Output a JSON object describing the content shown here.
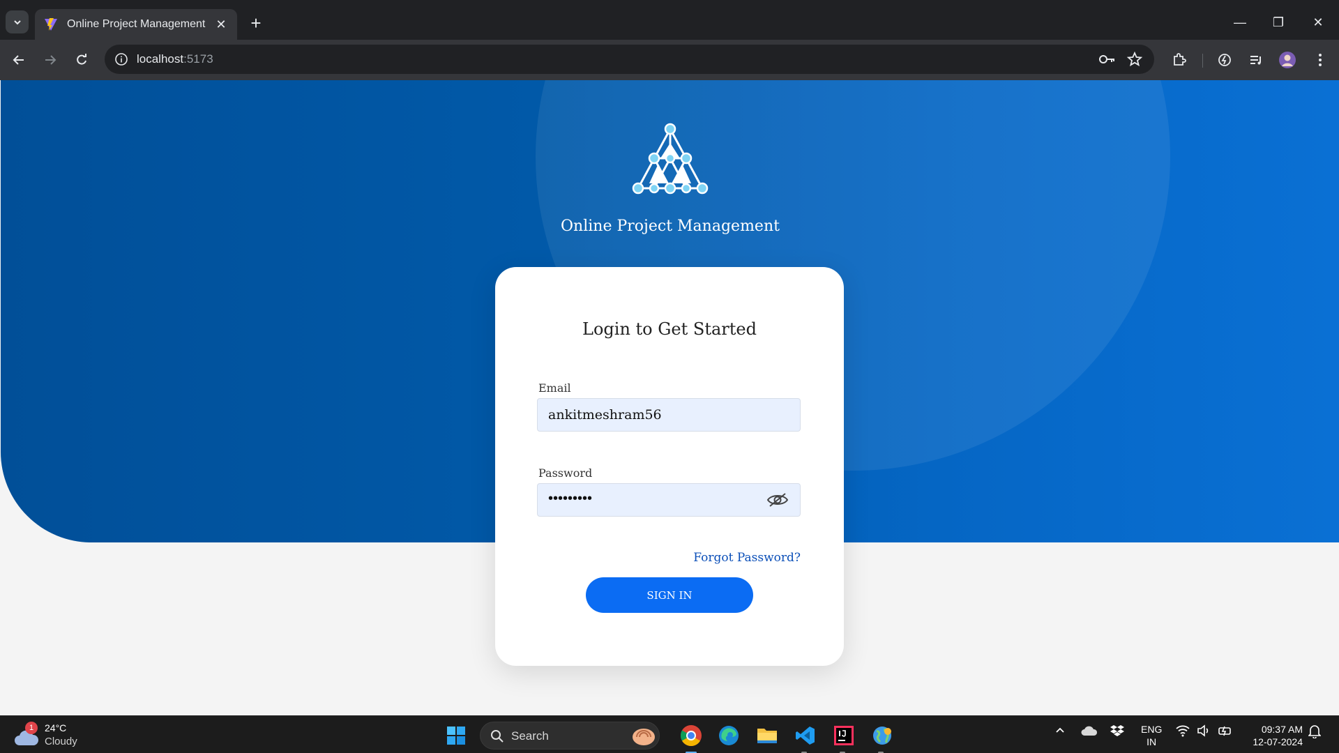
{
  "browser": {
    "tab_title": "Online Project Management",
    "tab_close": "✕",
    "new_tab": "+",
    "url_host": "localhost",
    "url_port": ":5173",
    "window": {
      "minimize": "—",
      "restore": "❐",
      "close": "✕"
    }
  },
  "page": {
    "app_title": "Online Project Management",
    "card_title": "Login to Get Started",
    "email_label": "Email",
    "email_value": "ankitmeshram56",
    "password_label": "Password",
    "password_masked": "•••••••••",
    "forgot_link": "Forgot Password?",
    "signin_button": "SIGN IN"
  },
  "taskbar": {
    "weather_badge": "1",
    "weather_temp": "24°C",
    "weather_condition": "Cloudy",
    "search_label": "Search",
    "lang_line1": "ENG",
    "lang_line2": "IN",
    "time": "09:37 AM",
    "date": "12-07-2024"
  },
  "colors": {
    "hero_dark": "#014f98",
    "hero_light": "#0a70d4",
    "primary_button": "#0b6cf3",
    "link": "#0b4fb8",
    "input_bg": "#e8f0fe"
  }
}
